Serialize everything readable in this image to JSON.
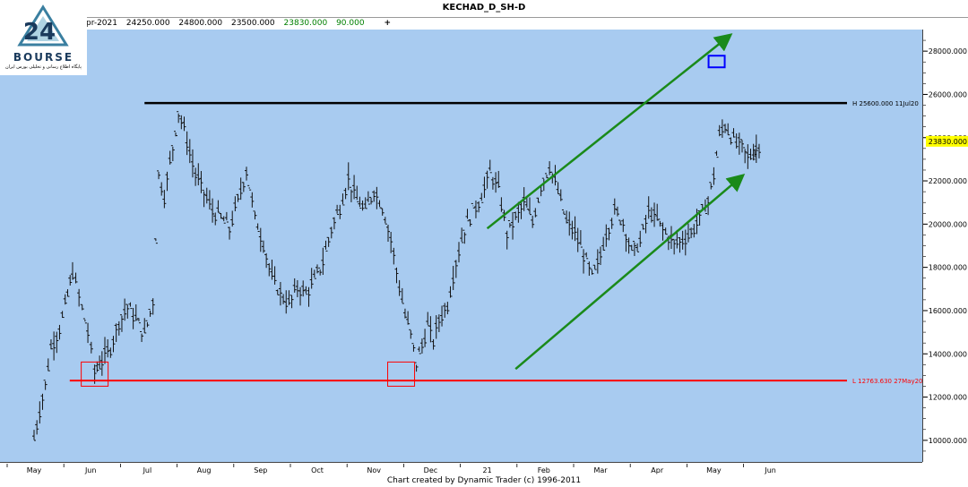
{
  "header": {
    "title": "KECHAD_D_SH-D",
    "date": "pr-2021",
    "open": "24250.000",
    "high": "24800.000",
    "low": "23500.000",
    "close": "23830.000",
    "change": "90.000",
    "add": "+"
  },
  "logo": {
    "word": "BOURSE",
    "numeral": "24",
    "tagline": "پایگاه اطلاع رسانی و تحلیلی بورس ایران"
  },
  "footer": "Chart created by Dynamic Trader  (c) 1996-2011",
  "colors": {
    "plot_bg": "#a8cbf0",
    "high_line": "#000000",
    "low_line": "#ff0000",
    "channel": "#1a8a1a",
    "target_box": "#0000ff",
    "last_price_bg": "#ffff00"
  },
  "chart_data": {
    "type": "ohlc",
    "title": "KECHAD_D_SH-D",
    "x_months": [
      "May",
      "Jun",
      "Jul",
      "Aug",
      "Sep",
      "Oct",
      "Nov",
      "Dec",
      "21",
      "Feb",
      "Mar",
      "Apr",
      "May",
      "Jun"
    ],
    "y_ticks": [
      "10000.000",
      "12000.000",
      "14000.000",
      "16000.000",
      "18000.000",
      "20000.000",
      "22000.000",
      "24000.000",
      "26000.000",
      "28000.000"
    ],
    "ylim": [
      9000,
      29000
    ],
    "last_price": "23830.000",
    "high_line": {
      "value": 25600,
      "label": "H 25600.000 11Jul20"
    },
    "low_line": {
      "value": 12763.63,
      "label": "L 12763.630 27May20"
    },
    "channel_upper": {
      "start": [
        8.0,
        19800
      ],
      "end": [
        12.27,
        28700
      ]
    },
    "channel_lower": {
      "start": [
        8.5,
        13300
      ],
      "end": [
        12.49,
        22200
      ]
    },
    "target_box": {
      "x": 12.05,
      "y": 27500
    },
    "low_markers": [
      {
        "x": 1.07,
        "y": 13000
      },
      {
        "x": 6.48,
        "y": 13000
      }
    ],
    "closes": [
      [
        0.0,
        10100
      ],
      [
        0.1,
        11400
      ],
      [
        0.2,
        12600
      ],
      [
        0.3,
        14300
      ],
      [
        0.45,
        15200
      ],
      [
        0.55,
        16200
      ],
      [
        0.68,
        17800
      ],
      [
        0.85,
        16100
      ],
      [
        0.95,
        15000
      ],
      [
        1.07,
        13200
      ],
      [
        1.2,
        13700
      ],
      [
        1.35,
        14300
      ],
      [
        1.5,
        15500
      ],
      [
        1.65,
        16200
      ],
      [
        1.8,
        15600
      ],
      [
        1.95,
        14900
      ],
      [
        2.1,
        16500
      ],
      [
        2.2,
        22300
      ],
      [
        2.3,
        21300
      ],
      [
        2.45,
        23600
      ],
      [
        2.55,
        25200
      ],
      [
        2.65,
        24400
      ],
      [
        2.75,
        23300
      ],
      [
        2.85,
        22300
      ],
      [
        3.0,
        21500
      ],
      [
        3.15,
        20600
      ],
      [
        3.3,
        20300
      ],
      [
        3.45,
        19800
      ],
      [
        3.6,
        21100
      ],
      [
        3.75,
        22500
      ],
      [
        3.9,
        20300
      ],
      [
        4.05,
        19100
      ],
      [
        4.2,
        17500
      ],
      [
        4.35,
        16800
      ],
      [
        4.5,
        16300
      ],
      [
        4.65,
        17100
      ],
      [
        4.8,
        16800
      ],
      [
        4.95,
        17400
      ],
      [
        5.1,
        18300
      ],
      [
        5.25,
        19800
      ],
      [
        5.4,
        20800
      ],
      [
        5.55,
        22100
      ],
      [
        5.7,
        21100
      ],
      [
        5.85,
        20600
      ],
      [
        6.0,
        21600
      ],
      [
        6.15,
        20800
      ],
      [
        6.3,
        19300
      ],
      [
        6.45,
        17100
      ],
      [
        6.55,
        15800
      ],
      [
        6.65,
        14900
      ],
      [
        6.75,
        13600
      ],
      [
        6.85,
        14400
      ],
      [
        6.95,
        15300
      ],
      [
        7.05,
        14600
      ],
      [
        7.15,
        15600
      ],
      [
        7.3,
        16300
      ],
      [
        7.45,
        18300
      ],
      [
        7.6,
        19800
      ],
      [
        7.75,
        20600
      ],
      [
        7.9,
        21300
      ],
      [
        8.05,
        22400
      ],
      [
        8.2,
        21600
      ],
      [
        8.35,
        19600
      ],
      [
        8.5,
        20300
      ],
      [
        8.65,
        21000
      ],
      [
        8.8,
        20100
      ],
      [
        8.95,
        21800
      ],
      [
        9.1,
        22700
      ],
      [
        9.25,
        21500
      ],
      [
        9.4,
        20100
      ],
      [
        9.55,
        19600
      ],
      [
        9.7,
        18600
      ],
      [
        9.85,
        17600
      ],
      [
        9.95,
        18100
      ],
      [
        10.1,
        19600
      ],
      [
        10.25,
        20600
      ],
      [
        10.4,
        20100
      ],
      [
        10.55,
        18700
      ],
      [
        10.7,
        19200
      ],
      [
        10.85,
        20600
      ],
      [
        11.0,
        20200
      ],
      [
        11.15,
        19600
      ],
      [
        11.3,
        19100
      ],
      [
        11.45,
        19300
      ],
      [
        11.6,
        19600
      ],
      [
        11.75,
        20300
      ],
      [
        11.9,
        21100
      ],
      [
        12.0,
        22300
      ],
      [
        12.1,
        24100
      ],
      [
        12.2,
        24600
      ],
      [
        12.3,
        24100
      ],
      [
        12.4,
        23700
      ],
      [
        12.5,
        23600
      ],
      [
        12.6,
        23100
      ],
      [
        12.7,
        23300
      ],
      [
        12.75,
        23500
      ],
      [
        12.85,
        23830
      ]
    ]
  }
}
